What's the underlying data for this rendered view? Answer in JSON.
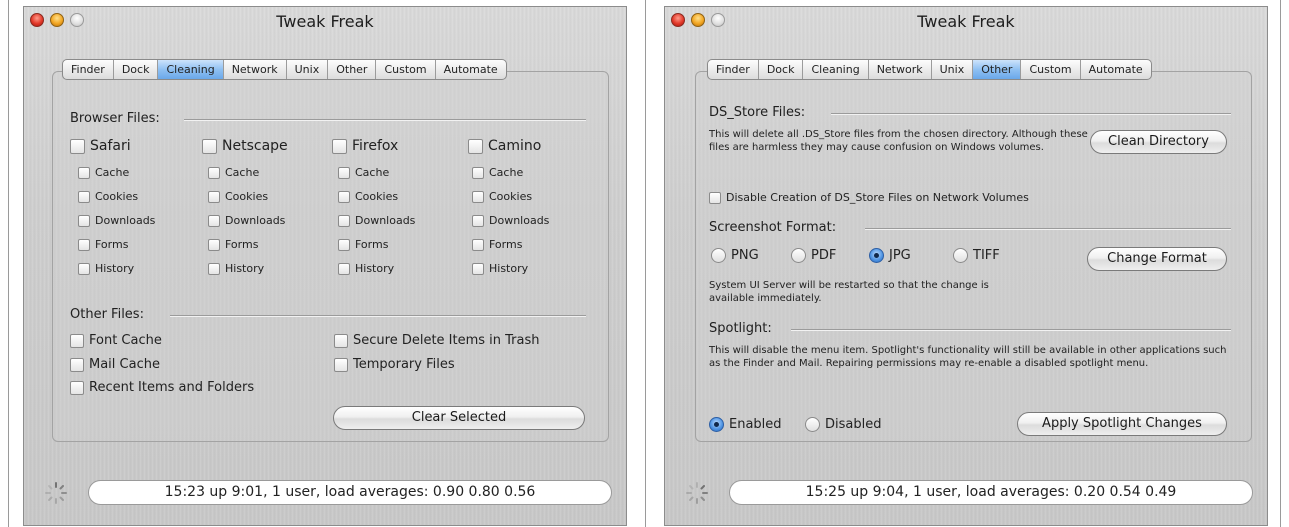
{
  "left": {
    "title": "Tweak Freak",
    "tabs": [
      "Finder",
      "Dock",
      "Cleaning",
      "Network",
      "Unix",
      "Other",
      "Custom",
      "Automate"
    ],
    "active_tab": "Cleaning",
    "browser_files_label": "Browser Files:",
    "browsers": [
      {
        "name": "Safari",
        "items": [
          "Cache",
          "Cookies",
          "Downloads",
          "Forms",
          "History"
        ]
      },
      {
        "name": "Netscape",
        "items": [
          "Cache",
          "Cookies",
          "Downloads",
          "Forms",
          "History"
        ]
      },
      {
        "name": "Firefox",
        "items": [
          "Cache",
          "Cookies",
          "Downloads",
          "Forms",
          "History"
        ]
      },
      {
        "name": "Camino",
        "items": [
          "Cache",
          "Cookies",
          "Downloads",
          "Forms",
          "History"
        ]
      }
    ],
    "other_files_label": "Other Files:",
    "other_files": {
      "font_cache": "Font Cache",
      "mail_cache": "Mail Cache",
      "recent_items": "Recent Items and Folders",
      "secure_delete": "Secure Delete Items in Trash",
      "temporary_files": "Temporary Files"
    },
    "clear_button": "Clear Selected",
    "status": "15:23  up  9:01, 1 user, load averages: 0.90 0.80 0.56"
  },
  "right": {
    "title": "Tweak Freak",
    "tabs": [
      "Finder",
      "Dock",
      "Cleaning",
      "Network",
      "Unix",
      "Other",
      "Custom",
      "Automate"
    ],
    "active_tab": "Other",
    "ds_store_label": "DS_Store Files:",
    "ds_store_desc": "This will delete all .DS_Store files from the chosen directory.  Although these files are harmless they may cause confusion on Windows volumes.",
    "clean_button": "Clean Directory",
    "disable_ds_store": "Disable Creation of DS_Store Files on Network Volumes",
    "screenshot_label": "Screenshot Format:",
    "formats": [
      {
        "label": "PNG",
        "selected": false
      },
      {
        "label": "PDF",
        "selected": false
      },
      {
        "label": "JPG",
        "selected": true
      },
      {
        "label": "TIFF",
        "selected": false
      }
    ],
    "change_format_button": "Change Format",
    "screenshot_note": "System UI Server will be restarted so that the change is available immediately.",
    "spotlight_label": "Spotlight:",
    "spotlight_desc": "This will disable the menu item.  Spotlight's functionality will still be available in other applications such as the Finder and Mail.  Repairing permissions may re-enable a disabled spotlight menu.",
    "spotlight_enabled": "Enabled",
    "spotlight_disabled": "Disabled",
    "spotlight_selected": "Enabled",
    "apply_spotlight_button": "Apply Spotlight Changes",
    "status": "15:25  up  9:04, 1 user, load averages: 0.20 0.54 0.49"
  }
}
